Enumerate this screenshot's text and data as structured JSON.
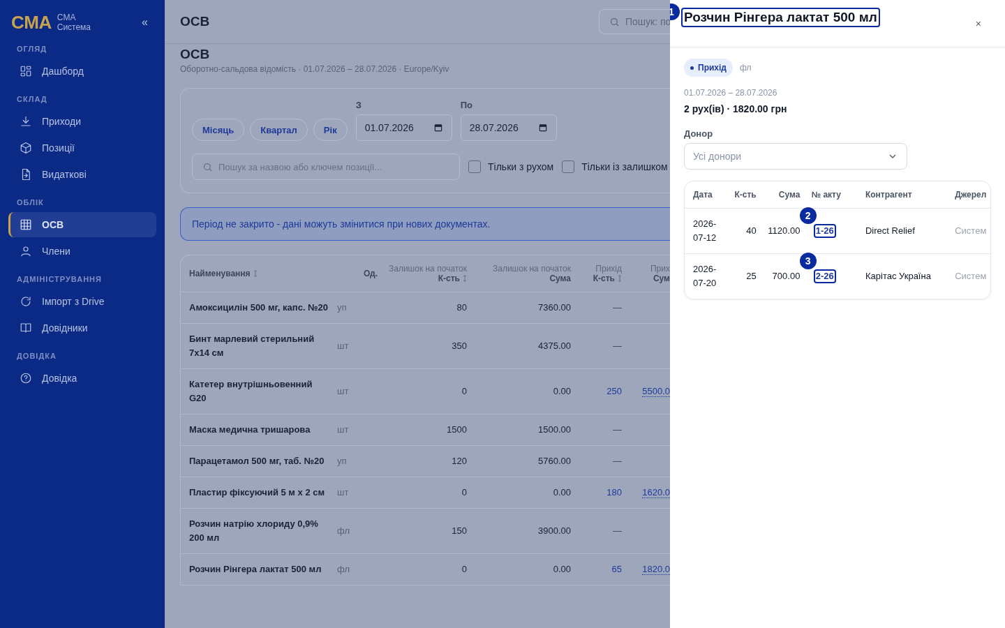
{
  "sidebar": {
    "logo": "CMA",
    "brand_line1": "CMA",
    "brand_line2": "Система",
    "collapse": "«",
    "sections": [
      {
        "title": "ОГЛЯД",
        "items": [
          {
            "label": "Дашборд",
            "kind": "dashboard",
            "selected": false
          }
        ]
      },
      {
        "title": "СКЛАД",
        "items": [
          {
            "label": "Приходи",
            "kind": "receipts",
            "selected": false
          },
          {
            "label": "Позиції",
            "kind": "items",
            "selected": false
          },
          {
            "label": "Видаткові",
            "kind": "issues",
            "selected": false
          }
        ]
      },
      {
        "title": "ОБЛІК",
        "items": [
          {
            "label": "ОСВ",
            "kind": "balance",
            "selected": true
          },
          {
            "label": "Члени",
            "kind": "members",
            "selected": false
          }
        ]
      },
      {
        "title": "АДМІНІСТРУВАННЯ",
        "items": [
          {
            "label": "Імпорт з Drive",
            "kind": "import",
            "selected": false
          },
          {
            "label": "Довідники",
            "kind": "directories",
            "selected": false
          }
        ]
      },
      {
        "title": "ДОВІДКА",
        "items": [
          {
            "label": "Довідка",
            "kind": "help",
            "selected": false
          }
        ]
      }
    ]
  },
  "header": {
    "title": "ОСВ",
    "search_placeholder": "Пошук: по"
  },
  "page": {
    "heading": "ОСВ",
    "subtitle": "Оборотно-сальдова відомість · 01.07.2026 – 28.07.2026 · Europe/Kyiv",
    "period_buttons": [
      "Місяць",
      "Квартал",
      "Рік"
    ],
    "from": {
      "label": "З",
      "value": "01.07.2026"
    },
    "to": {
      "label": "По",
      "value": "28.07.2026"
    },
    "search_placeholder": "Пошук за назвою або ключем позиції...",
    "checkboxes": [
      {
        "label": "Тільки з рухом",
        "checked": false
      },
      {
        "label": "Тільки із залишком",
        "checked": false
      }
    ],
    "alert": "Період не закрито - дані можуть змінитися при нових документах."
  },
  "table": {
    "columns": [
      {
        "label": "Найменування",
        "sortable": true
      },
      {
        "label": "Од.",
        "sortable": false
      },
      {
        "top": "Залишок на початок",
        "label": "К-сть",
        "sortable": true
      },
      {
        "top": "Залишок на початок",
        "label": "Сума",
        "sortable": false
      },
      {
        "top": "Прихід",
        "label": "К-сть",
        "sortable": true
      },
      {
        "top": "Прих",
        "label": "Сум",
        "sortable": false
      }
    ],
    "rows": [
      {
        "name": "Амоксицилін 500 мг, капс. №20",
        "unit": "уп",
        "qty": "80",
        "sum": "7360.00",
        "in_qty": "—",
        "has_income": false
      },
      {
        "name": "Бинт марлевий стерильний 7x14 см",
        "unit": "шт",
        "qty": "350",
        "sum": "4375.00",
        "in_qty": "—",
        "has_income": false
      },
      {
        "name": "Катетер внутрішньовенний G20",
        "unit": "шт",
        "qty": "0",
        "sum": "0.00",
        "in_qty": "250",
        "in_sum": "5500.0",
        "has_income": true
      },
      {
        "name": "Маска медична тришарова",
        "unit": "шт",
        "qty": "1500",
        "sum": "1500.00",
        "in_qty": "—",
        "has_income": false
      },
      {
        "name": "Парацетамол 500 мг, таб. №20",
        "unit": "уп",
        "qty": "120",
        "sum": "5760.00",
        "in_qty": "—",
        "has_income": false
      },
      {
        "name": "Пластир фіксуючий 5 м х 2 см",
        "unit": "шт",
        "qty": "0",
        "sum": "0.00",
        "in_qty": "180",
        "in_sum": "1620.0",
        "has_income": true
      },
      {
        "name": "Розчин натрію хлориду 0,9% 200 мл",
        "unit": "фл",
        "qty": "150",
        "sum": "3900.00",
        "in_qty": "—",
        "has_income": false
      },
      {
        "name": "Розчин Рінгера лактат 500 мл",
        "unit": "фл",
        "qty": "0",
        "sum": "0.00",
        "in_qty": "65",
        "in_sum": "1820.0",
        "has_income": true
      }
    ]
  },
  "drawer": {
    "title": "Розчин Рінгера лактат 500 мл",
    "title_hint": "1",
    "close": "×",
    "tag": "Прихід",
    "unit": "фл",
    "period": "01.07.2026 – 28.07.2026",
    "summary": "2 рух(ів) · 1820.00 грн",
    "donor_label": "Донор",
    "donor_value": "Усі донори",
    "columns": [
      "Дата",
      "К-сть",
      "Сума",
      "№ акту",
      "Контрагент",
      "Джерел"
    ],
    "rows": [
      {
        "date": "2026-07-12",
        "qty": "40",
        "sum": "1120.00",
        "act": "1-26",
        "hint": "2",
        "counterparty": "Direct Relief",
        "source": "Систем"
      },
      {
        "date": "2026-07-20",
        "qty": "25",
        "sum": "700.00",
        "act": "2-26",
        "hint": "3",
        "counterparty": "Карітас Україна",
        "source": "Систем"
      }
    ]
  }
}
